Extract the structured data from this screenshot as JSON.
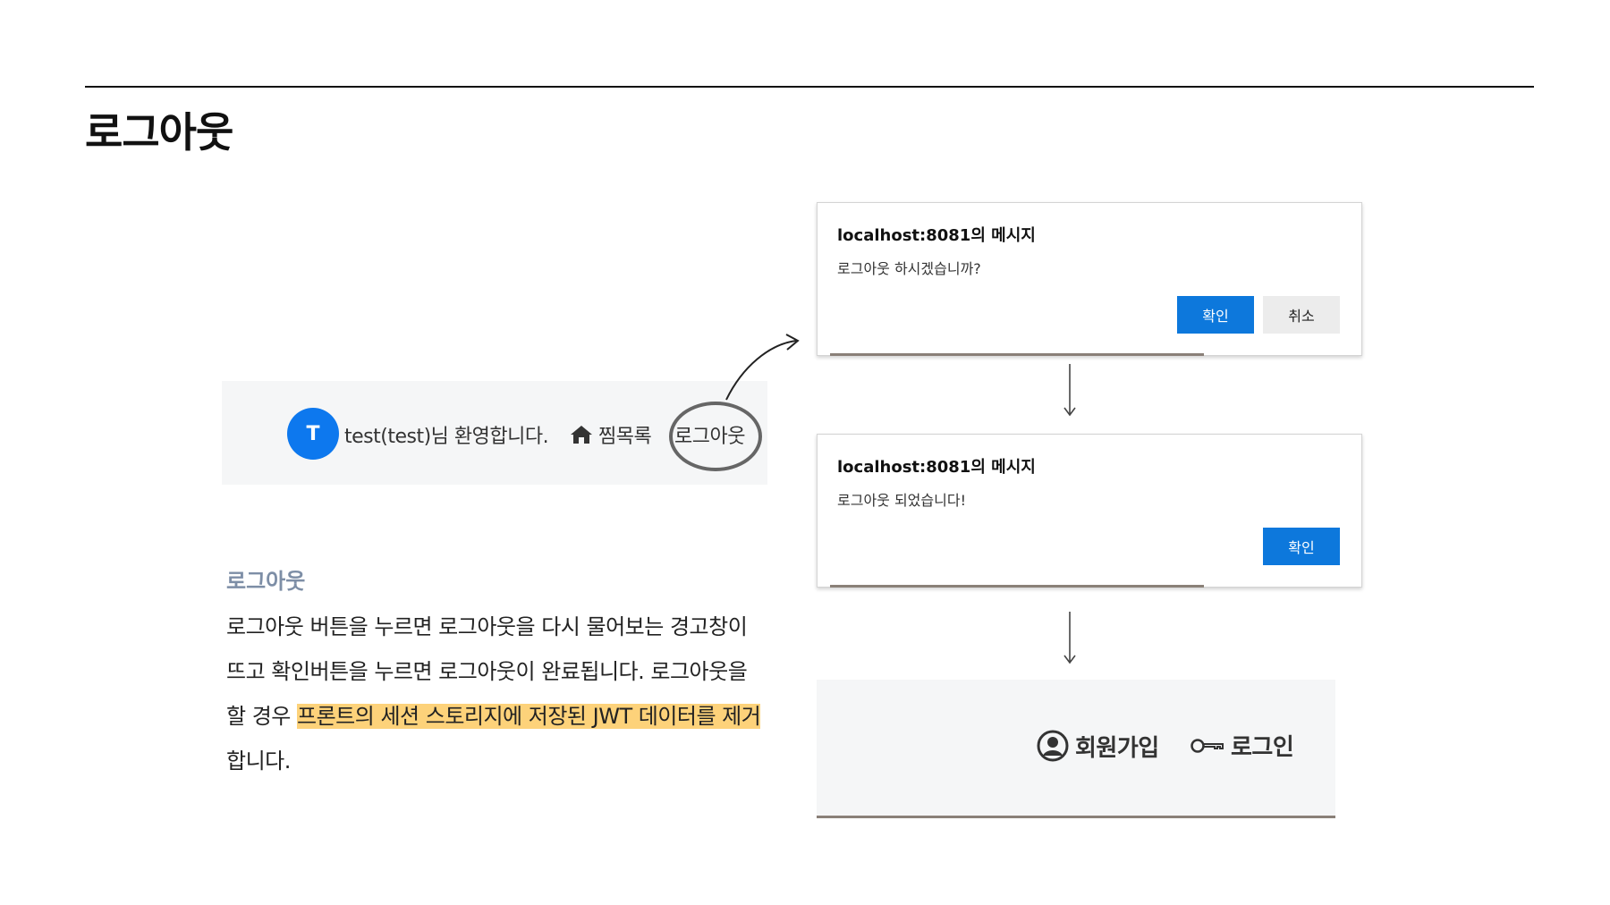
{
  "page": {
    "title": "로그아웃"
  },
  "navbar": {
    "avatar_letter": "T",
    "welcome_text": "test(test)님 환영합니다.",
    "wishlist_label": "찜목록",
    "logout_label": "로그아웃"
  },
  "description": {
    "heading": "로그아웃",
    "text_before": "로그아웃 버튼을 누르면 로그아웃을 다시 물어보는 경고창이 뜨고 확인버튼을 누르면 로그아웃이 완료됩니다. 로그아웃을 할 경우 ",
    "text_highlight": "프론트의 세션 스토리지에 저장된 JWT 데이터를 제거",
    "text_after": "합니다."
  },
  "dialog_confirm": {
    "title": "localhost:8081의 메시지",
    "message": "로그아웃 하시겠습니까?",
    "ok_label": "확인",
    "cancel_label": "취소"
  },
  "dialog_done": {
    "title": "localhost:8081의 메시지",
    "message": "로그아웃 되었습니다!",
    "ok_label": "확인"
  },
  "bottom_nav": {
    "signup_label": "회원가입",
    "login_label": "로그인"
  },
  "colors": {
    "accent_blue": "#0d78dc",
    "highlight": "#fdd27a",
    "heading_gray": "#7d8ea6"
  }
}
